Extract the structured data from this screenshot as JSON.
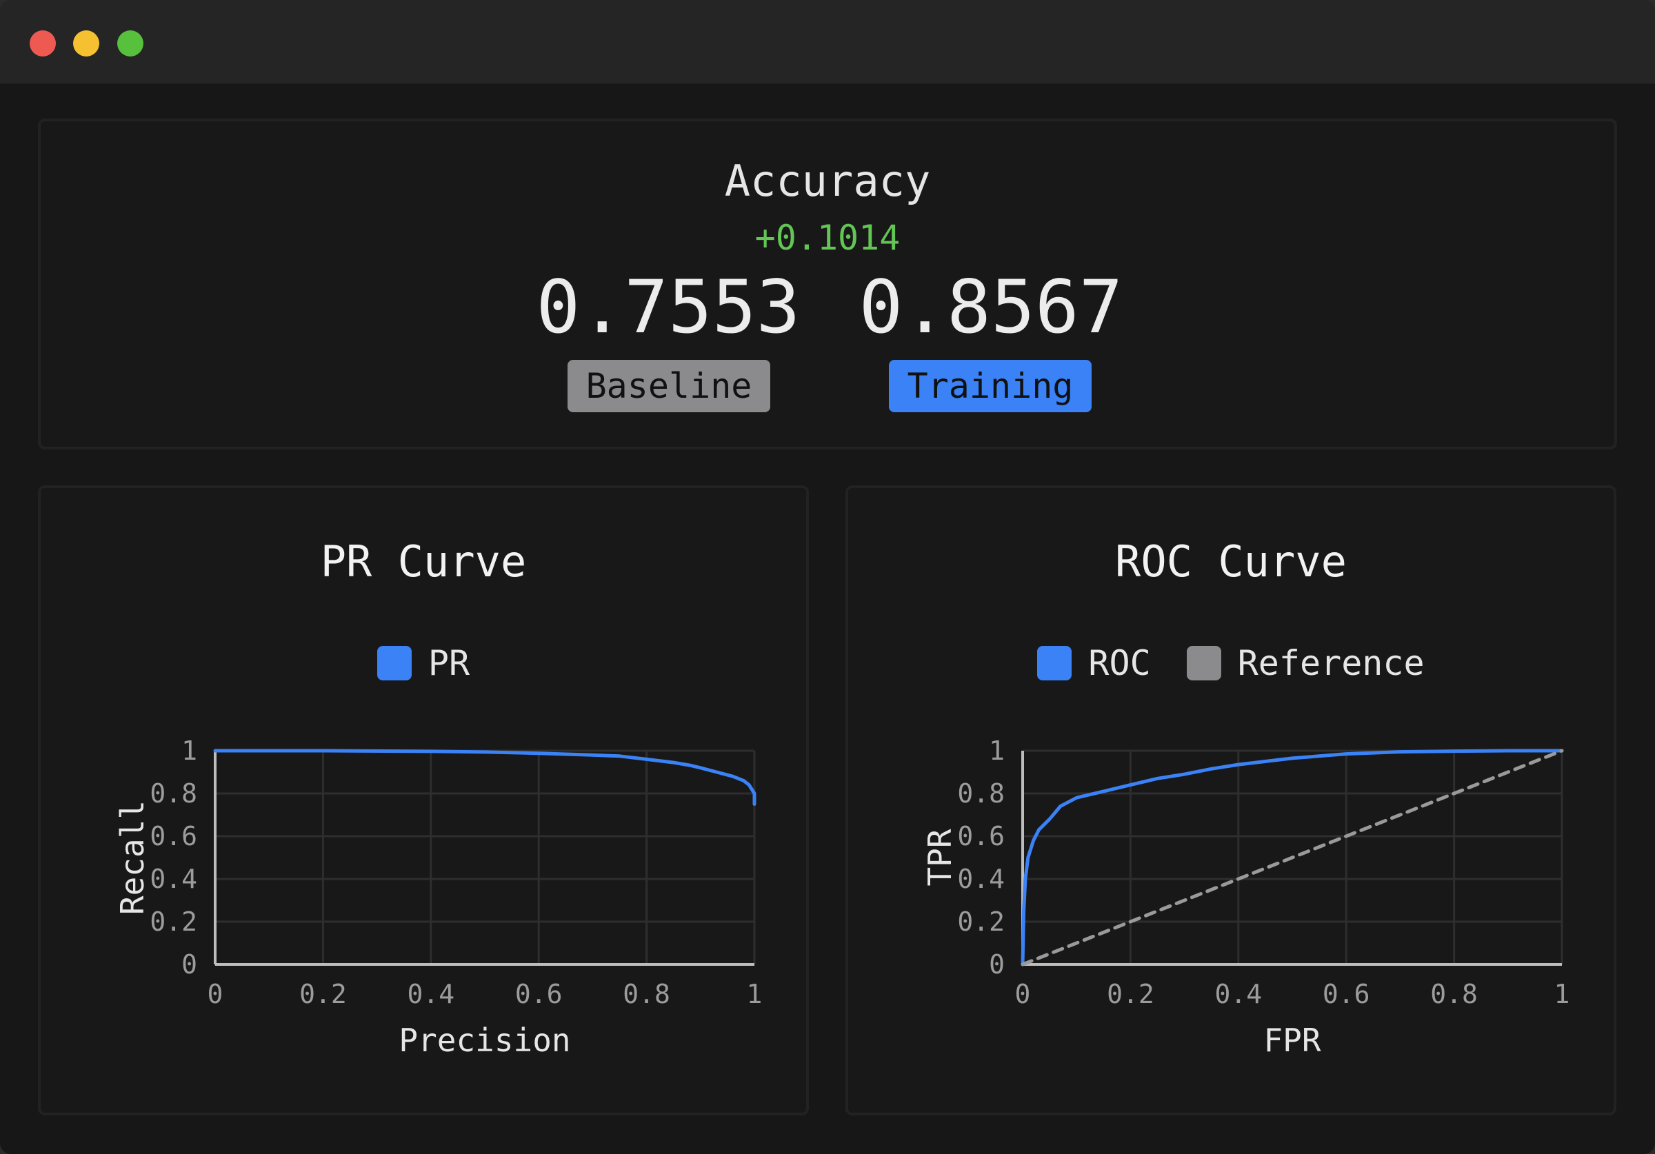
{
  "accuracy": {
    "title": "Accuracy",
    "delta": "+0.1014",
    "baseline_value": "0.7553",
    "training_value": "0.8567",
    "baseline_label": "Baseline",
    "training_label": "Training",
    "delta_color": "#62c554",
    "baseline_color": "#8b8b8e",
    "training_color": "#3a82f6"
  },
  "pr_chart": {
    "title": "PR Curve",
    "legend": [
      {
        "label": "PR",
        "color": "#3a82f6"
      }
    ]
  },
  "roc_chart": {
    "title": "ROC Curve",
    "legend": [
      {
        "label": "ROC",
        "color": "#3a82f6"
      },
      {
        "label": "Reference",
        "color": "#8b8b8e"
      }
    ]
  },
  "chart_data": [
    {
      "type": "line",
      "title": "PR Curve",
      "xlabel": "Precision",
      "ylabel": "Recall",
      "xlim": [
        0,
        1
      ],
      "ylim": [
        0,
        1
      ],
      "xticks": [
        "0",
        "0.2",
        "0.4",
        "0.6",
        "0.8",
        "1"
      ],
      "yticks": [
        "0",
        "0.2",
        "0.4",
        "0.6",
        "0.8",
        "1"
      ],
      "grid": true,
      "legend_position": "top",
      "series": [
        {
          "name": "PR",
          "color": "#3a82f6",
          "x": [
            0,
            0.2,
            0.4,
            0.5,
            0.6,
            0.7,
            0.75,
            0.8,
            0.85,
            0.88,
            0.9,
            0.93,
            0.96,
            0.98,
            0.99,
            0.995,
            1.0,
            1.0
          ],
          "y": [
            1.0,
            1.0,
            0.997,
            0.994,
            0.988,
            0.98,
            0.975,
            0.96,
            0.945,
            0.932,
            0.92,
            0.9,
            0.88,
            0.86,
            0.84,
            0.82,
            0.8,
            0.75
          ]
        }
      ]
    },
    {
      "type": "line",
      "title": "ROC Curve",
      "xlabel": "FPR",
      "ylabel": "TPR",
      "xlim": [
        0,
        1
      ],
      "ylim": [
        0,
        1
      ],
      "xticks": [
        "0",
        "0.2",
        "0.4",
        "0.6",
        "0.8",
        "1"
      ],
      "yticks": [
        "0",
        "0.2",
        "0.4",
        "0.6",
        "0.8",
        "1"
      ],
      "grid": true,
      "legend_position": "top",
      "series": [
        {
          "name": "ROC",
          "color": "#3a82f6",
          "x": [
            0,
            0.002,
            0.005,
            0.01,
            0.02,
            0.03,
            0.05,
            0.07,
            0.1,
            0.15,
            0.2,
            0.25,
            0.3,
            0.35,
            0.4,
            0.45,
            0.5,
            0.6,
            0.7,
            0.8,
            0.9,
            1.0
          ],
          "y": [
            0,
            0.25,
            0.4,
            0.5,
            0.58,
            0.63,
            0.68,
            0.74,
            0.78,
            0.81,
            0.84,
            0.87,
            0.89,
            0.915,
            0.935,
            0.95,
            0.965,
            0.985,
            0.995,
            0.998,
            1.0,
            1.0
          ]
        },
        {
          "name": "Reference",
          "color": "#9a9a9a",
          "dashed": true,
          "x": [
            0,
            1
          ],
          "y": [
            0,
            1
          ]
        }
      ]
    }
  ]
}
